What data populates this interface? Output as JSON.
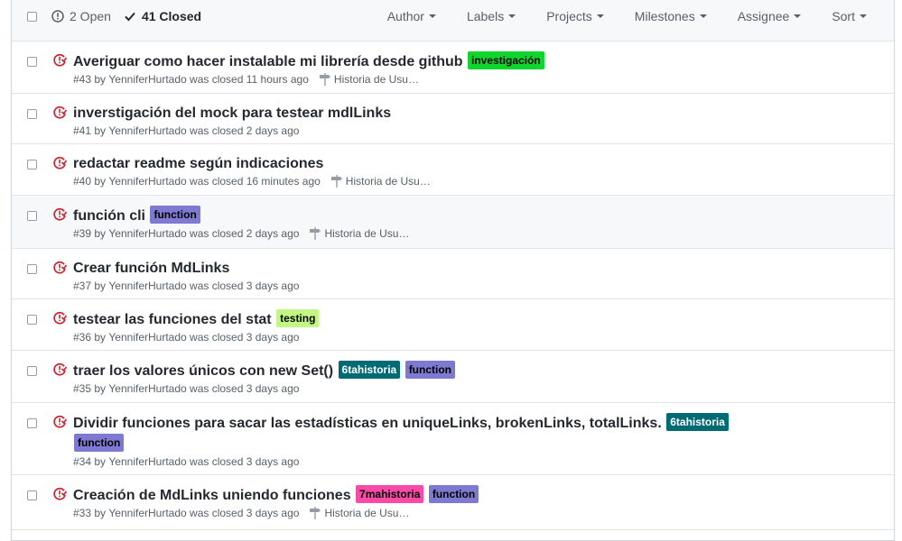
{
  "header": {
    "open_label": "2 Open",
    "closed_label": "41 Closed",
    "filters": [
      "Author",
      "Labels",
      "Projects",
      "Milestones",
      "Assignee",
      "Sort"
    ]
  },
  "colors": {
    "closed_icon": "#cb2431",
    "label_investigacion": "#0ed62c",
    "label_function": "#7f7ad1",
    "label_testing": "#c3f783",
    "label_6tahistoria": "#006b75",
    "label_7mahistoria": "#f74ba7"
  },
  "issues": [
    {
      "title": "Averiguar como hacer instalable mi librería desde github",
      "labels": [
        "investigación"
      ],
      "number": "#43",
      "by": "by",
      "author": "YenniferHurtado",
      "closed": "was closed 11 hours ago",
      "milestone": "Historia de Usu…"
    },
    {
      "title": "inverstigación del mock para testear mdlLinks",
      "labels": [],
      "number": "#41",
      "by": "by",
      "author": "YenniferHurtado",
      "closed": "was closed 2 days ago",
      "milestone": ""
    },
    {
      "title": "redactar readme según indicaciones",
      "labels": [],
      "number": "#40",
      "by": "by",
      "author": "YenniferHurtado",
      "closed": "was closed 16 minutes ago",
      "milestone": "Historia de Usu…"
    },
    {
      "title": "función cli",
      "labels": [
        "function"
      ],
      "number": "#39",
      "by": "by",
      "author": "YenniferHurtado",
      "closed": "was closed 2 days ago",
      "milestone": "Historia de Usu…"
    },
    {
      "title": "Crear función MdLinks",
      "labels": [],
      "number": "#37",
      "by": "by",
      "author": "YenniferHurtado",
      "closed": "was closed 3 days ago",
      "milestone": ""
    },
    {
      "title": "testear las funciones del stat",
      "labels": [
        "testing"
      ],
      "number": "#36",
      "by": "by",
      "author": "YenniferHurtado",
      "closed": "was closed 3 days ago",
      "milestone": ""
    },
    {
      "title": "traer los valores únicos con new Set()",
      "labels": [
        "6tahistoria",
        "function"
      ],
      "number": "#35",
      "by": "by",
      "author": "YenniferHurtado",
      "closed": "was closed 3 days ago",
      "milestone": ""
    },
    {
      "title": "Dividir funciones para sacar las estadísticas en uniqueLinks, brokenLinks, totalLinks.",
      "labels": [
        "6tahistoria",
        "function"
      ],
      "number": "#34",
      "by": "by",
      "author": "YenniferHurtado",
      "closed": "was closed 3 days ago",
      "milestone": ""
    },
    {
      "title": "Creación de MdLinks uniendo funciones",
      "labels": [
        "7mahistoria",
        "function"
      ],
      "number": "#33",
      "by": "by",
      "author": "YenniferHurtado",
      "closed": "was closed 3 days ago",
      "milestone": "Historia de Usu…"
    }
  ]
}
